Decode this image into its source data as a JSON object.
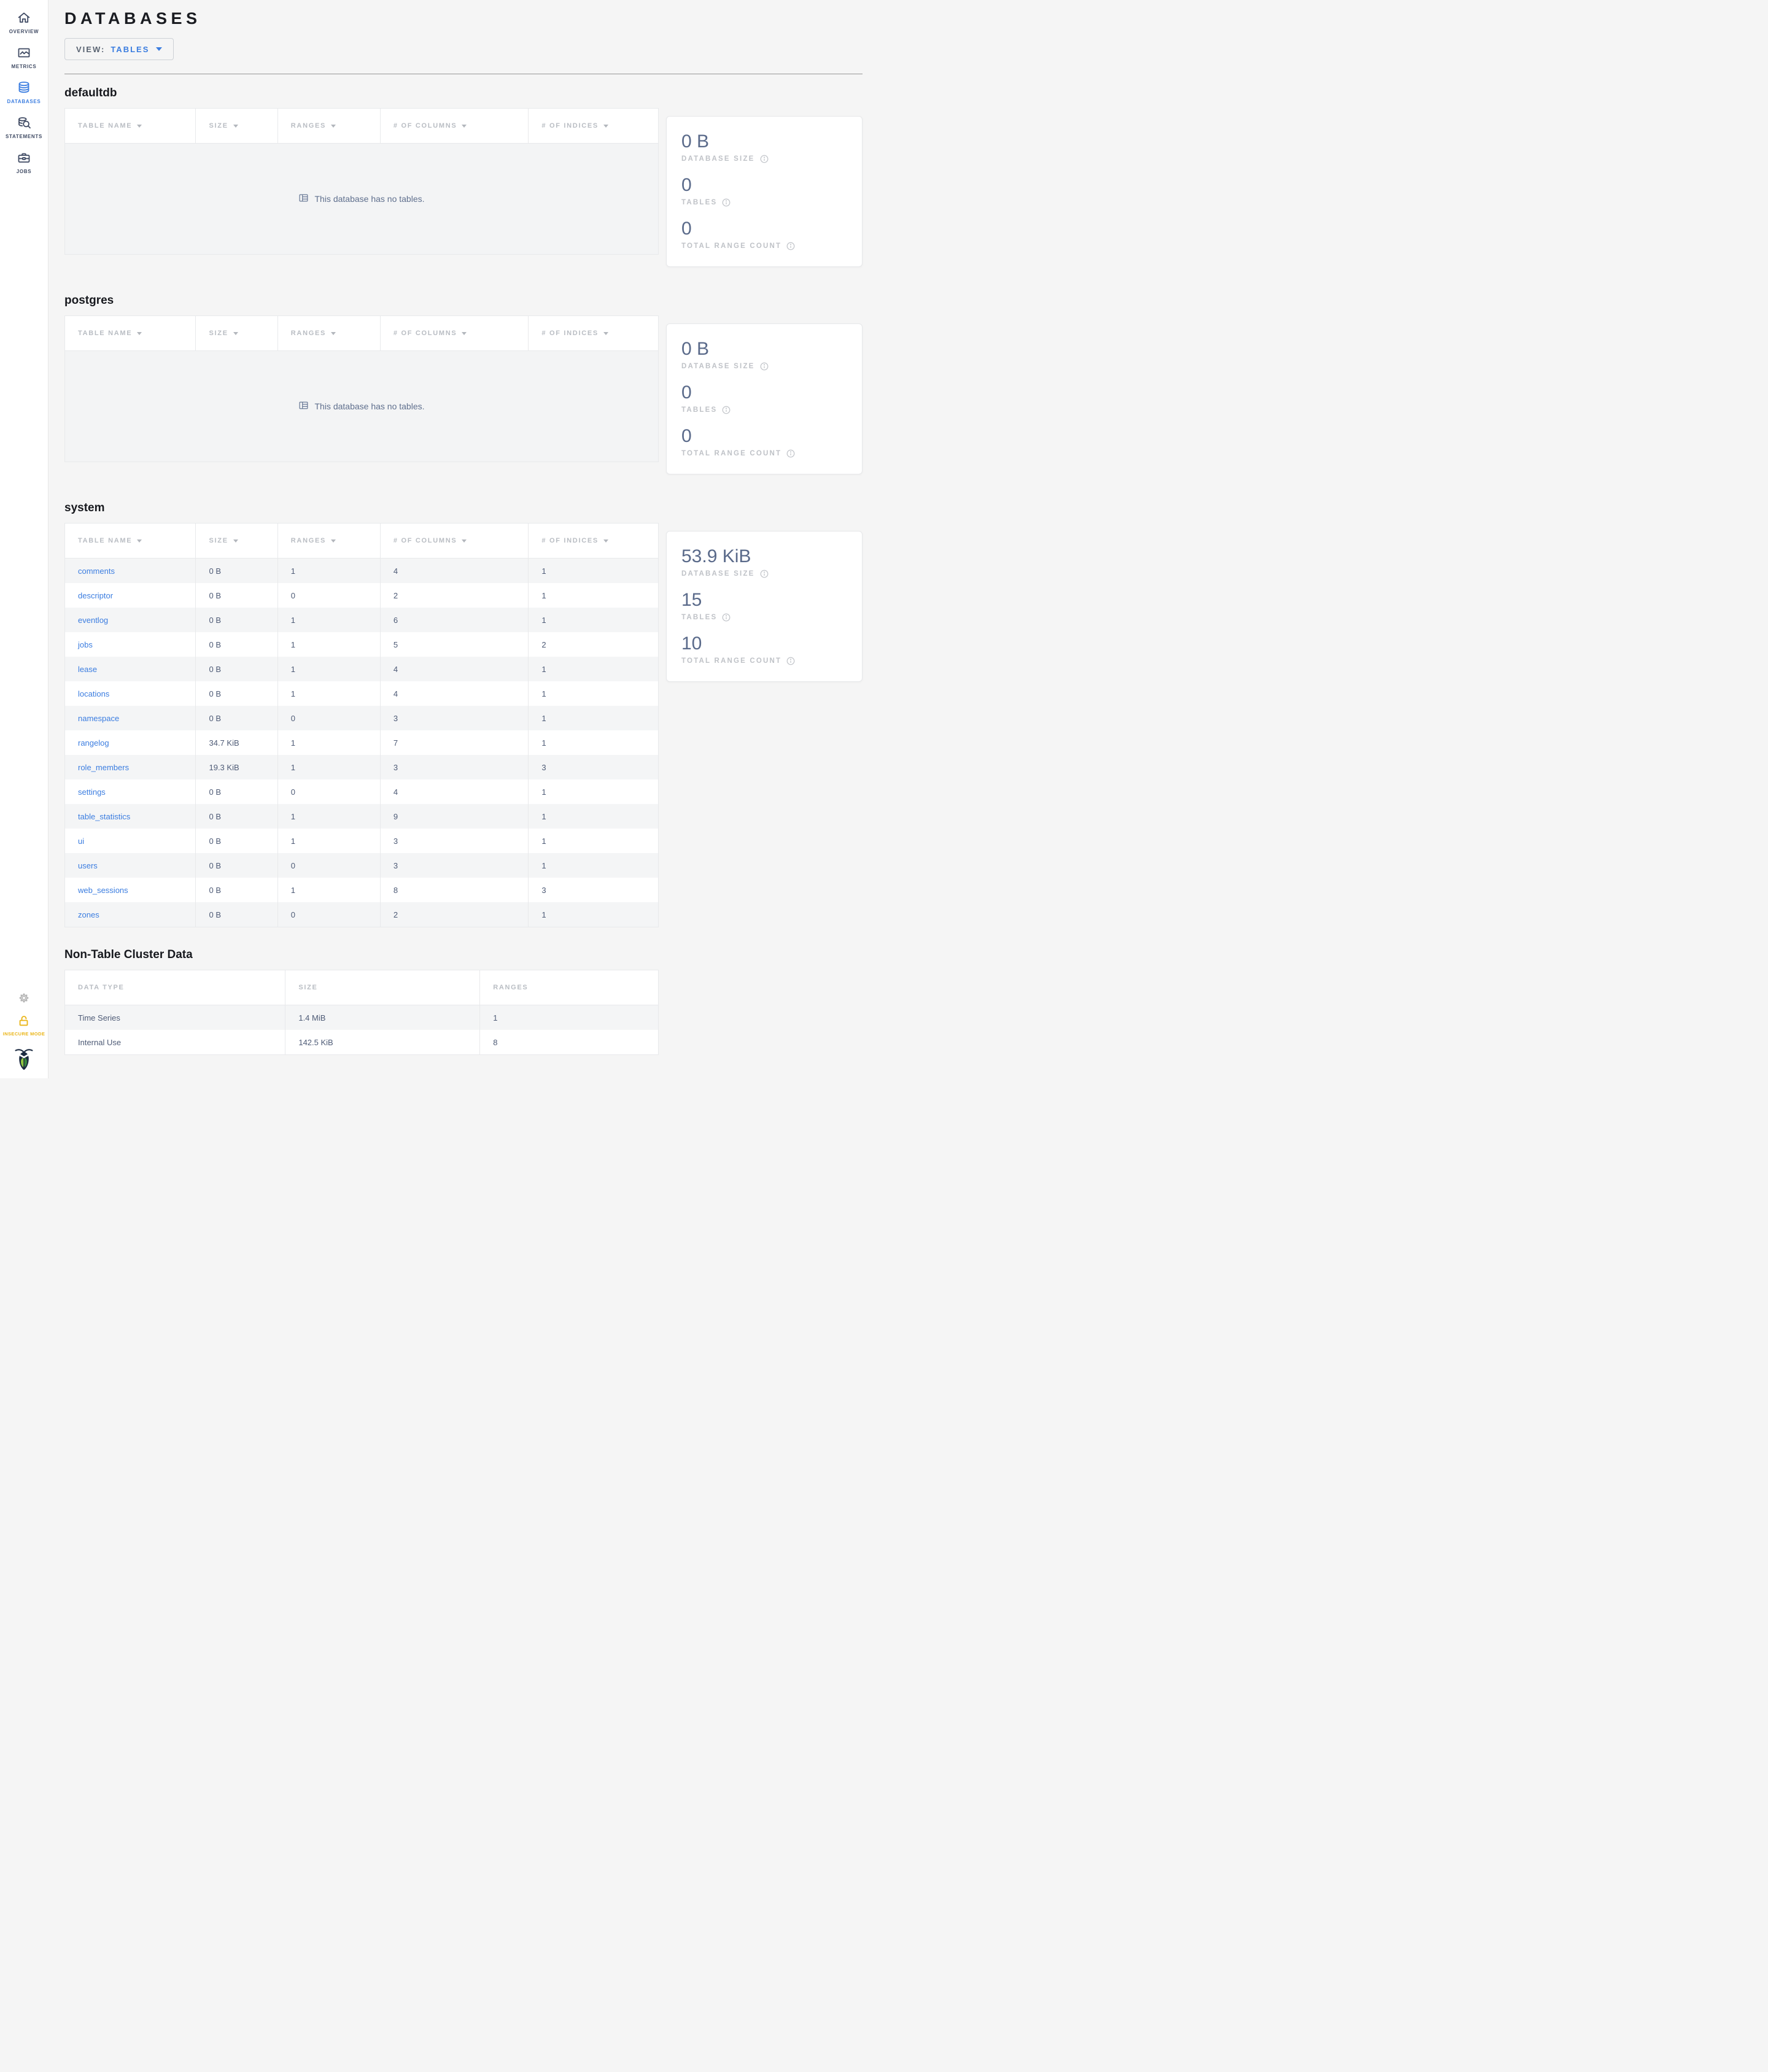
{
  "colors": {
    "accent": "#3b7de0",
    "insecure": "#eab517"
  },
  "sidebar": {
    "items": [
      {
        "label": "OVERVIEW",
        "icon": "home-icon",
        "active": false
      },
      {
        "label": "METRICS",
        "icon": "metrics-icon",
        "active": false
      },
      {
        "label": "DATABASES",
        "icon": "databases-icon",
        "active": true
      },
      {
        "label": "STATEMENTS",
        "icon": "statements-icon",
        "active": false
      },
      {
        "label": "JOBS",
        "icon": "jobs-icon",
        "active": false
      }
    ],
    "insecure_label": "INSECURE MODE"
  },
  "header": {
    "title": "DATABASES",
    "view_label": "VIEW:",
    "view_value": "TABLES"
  },
  "table_columns": [
    "TABLE NAME",
    "SIZE",
    "RANGES",
    "# OF COLUMNS",
    "# OF INDICES"
  ],
  "stats_labels": {
    "size": "DATABASE SIZE",
    "tables": "TABLES",
    "ranges": "TOTAL RANGE COUNT"
  },
  "empty_message": "This database has no tables.",
  "databases": [
    {
      "name": "defaultdb",
      "empty": true,
      "stats": {
        "size": "0 B",
        "tables": "0",
        "ranges": "0"
      }
    },
    {
      "name": "postgres",
      "empty": true,
      "stats": {
        "size": "0 B",
        "tables": "0",
        "ranges": "0"
      }
    },
    {
      "name": "system",
      "empty": false,
      "stats": {
        "size": "53.9 KiB",
        "tables": "15",
        "ranges": "10"
      },
      "rows": [
        {
          "name": "comments",
          "size": "0 B",
          "ranges": "1",
          "columns": "4",
          "indices": "1"
        },
        {
          "name": "descriptor",
          "size": "0 B",
          "ranges": "0",
          "columns": "2",
          "indices": "1"
        },
        {
          "name": "eventlog",
          "size": "0 B",
          "ranges": "1",
          "columns": "6",
          "indices": "1"
        },
        {
          "name": "jobs",
          "size": "0 B",
          "ranges": "1",
          "columns": "5",
          "indices": "2"
        },
        {
          "name": "lease",
          "size": "0 B",
          "ranges": "1",
          "columns": "4",
          "indices": "1"
        },
        {
          "name": "locations",
          "size": "0 B",
          "ranges": "1",
          "columns": "4",
          "indices": "1"
        },
        {
          "name": "namespace",
          "size": "0 B",
          "ranges": "0",
          "columns": "3",
          "indices": "1"
        },
        {
          "name": "rangelog",
          "size": "34.7 KiB",
          "ranges": "1",
          "columns": "7",
          "indices": "1"
        },
        {
          "name": "role_members",
          "size": "19.3 KiB",
          "ranges": "1",
          "columns": "3",
          "indices": "3"
        },
        {
          "name": "settings",
          "size": "0 B",
          "ranges": "0",
          "columns": "4",
          "indices": "1"
        },
        {
          "name": "table_statistics",
          "size": "0 B",
          "ranges": "1",
          "columns": "9",
          "indices": "1"
        },
        {
          "name": "ui",
          "size": "0 B",
          "ranges": "1",
          "columns": "3",
          "indices": "1"
        },
        {
          "name": "users",
          "size": "0 B",
          "ranges": "0",
          "columns": "3",
          "indices": "1"
        },
        {
          "name": "web_sessions",
          "size": "0 B",
          "ranges": "1",
          "columns": "8",
          "indices": "3"
        },
        {
          "name": "zones",
          "size": "0 B",
          "ranges": "0",
          "columns": "2",
          "indices": "1"
        }
      ]
    }
  ],
  "non_table": {
    "title": "Non-Table Cluster Data",
    "columns": [
      "DATA TYPE",
      "SIZE",
      "RANGES"
    ],
    "rows": [
      {
        "type": "Time Series",
        "size": "1.4 MiB",
        "ranges": "1"
      },
      {
        "type": "Internal Use",
        "size": "142.5 KiB",
        "ranges": "8"
      }
    ]
  }
}
